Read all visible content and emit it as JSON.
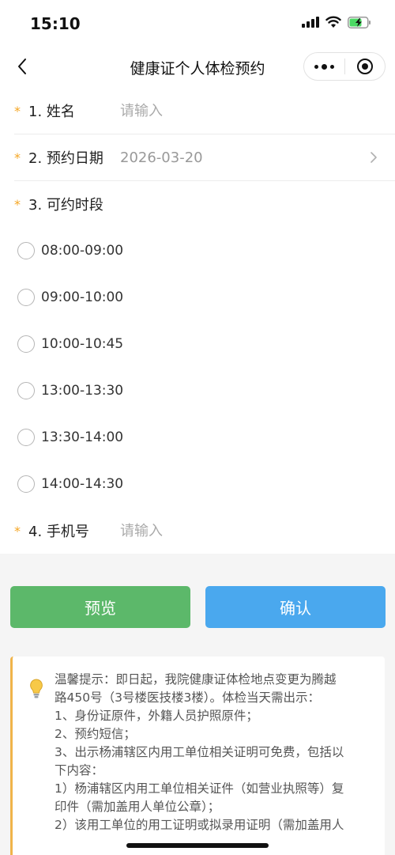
{
  "status_bar": {
    "time": "15:10"
  },
  "nav": {
    "title": "健康证个人体检预约"
  },
  "form": {
    "name": {
      "star": "*",
      "label": "1. 姓名",
      "placeholder": "请输入"
    },
    "date": {
      "star": "*",
      "label": "2. 预约日期",
      "value": "2026-03-20"
    },
    "slots": {
      "star": "*",
      "label": "3. 可约时段",
      "options": [
        "08:00-09:00",
        "09:00-10:00",
        "10:00-10:45",
        "13:00-13:30",
        "13:30-14:00",
        "14:00-14:30"
      ]
    },
    "phone": {
      "star": "*",
      "label": "4. 手机号",
      "placeholder": "请输入"
    }
  },
  "buttons": {
    "preview": "预览",
    "confirm": "确认"
  },
  "notice": {
    "lines": [
      "温馨提示：即日起，我院健康证体检地点变更为腾越",
      "路450号（3号楼医技楼3楼）。体检当天需出示：",
      "1、身份证原件，外籍人员护照原件；",
      "2、预约短信；",
      "3、出示杨浦辖区内用工单位相关证明可免费，包括以",
      "下内容：",
      "1）杨浦辖区内用工单位相关证件（如营业执照等）复",
      "印件（需加盖用人单位公章）；",
      "2）该用工单位的用工证明或拟录用证明（需加盖用人"
    ]
  },
  "colors": {
    "star": "#f5a623",
    "preview": "#5cb86a",
    "confirm": "#4aa8ee",
    "notice_border": "#f0b44a"
  }
}
